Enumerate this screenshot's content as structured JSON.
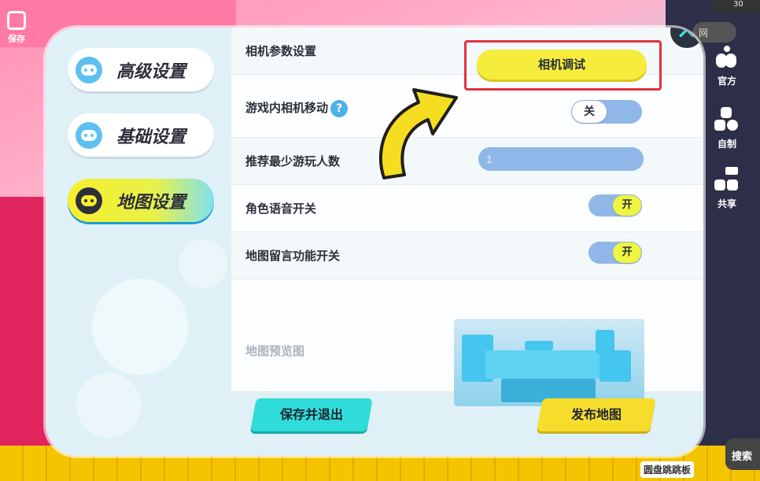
{
  "background": {
    "top_left_tool": {
      "label": "保存"
    },
    "right_tools": [
      {
        "label": "官方",
        "icon": "apple-icon"
      },
      {
        "label": "自制",
        "icon": "blocks-icon"
      },
      {
        "label": "共享",
        "icon": "share-icon"
      }
    ],
    "search_label": "搜索",
    "top_search_text": "网",
    "top_counter": "30",
    "bottom_right_label": "圆盘跳跳板"
  },
  "dialog": {
    "close_icon": "close-icon",
    "tabs": [
      {
        "label": "高级设置",
        "icon": "robot-icon",
        "active": false
      },
      {
        "label": "基础设置",
        "icon": "robot-icon",
        "active": false
      },
      {
        "label": "地图设置",
        "icon": "robot-icon",
        "active": true
      }
    ],
    "settings": {
      "camera_params": {
        "label": "相机参数设置",
        "button_label": "相机调试"
      },
      "ingame_camera_move": {
        "label": "游戏内相机移动",
        "help": "?",
        "toggle_value": "关"
      },
      "min_players": {
        "label": "推荐最少游玩人数",
        "value": "1"
      },
      "character_voice": {
        "label": "角色语音开关",
        "toggle_value": "开"
      },
      "map_message": {
        "label": "地图留言功能开关",
        "toggle_value": "开"
      },
      "map_preview": {
        "label": "地图预览图"
      }
    },
    "buttons": {
      "save_exit": "保存并退出",
      "publish": "发布地图"
    }
  },
  "colors": {
    "accent_yellow": "#f5ec3b",
    "accent_cyan": "#2fdcd9",
    "highlight_red": "#e2323f",
    "toggle_blue": "#8fb8e8"
  }
}
